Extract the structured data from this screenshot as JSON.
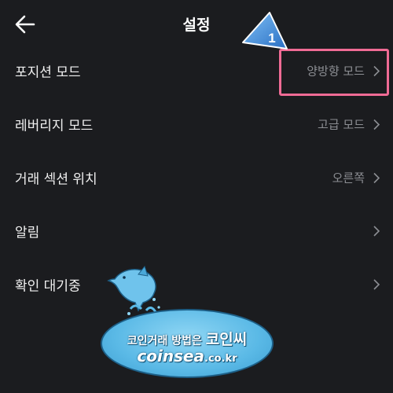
{
  "header": {
    "title": "설정",
    "back_icon": "arrow-left-icon"
  },
  "rows": [
    {
      "label": "포지션 모드",
      "value": "양방향 모드"
    },
    {
      "label": "레버리지 모드",
      "value": "고급 모드"
    },
    {
      "label": "거래 섹션 위치",
      "value": "오른쪽"
    },
    {
      "label": "알림",
      "value": ""
    },
    {
      "label": "확인 대기중",
      "value": ""
    }
  ],
  "annotation": {
    "step_number": "1",
    "color": "#f06b95",
    "pointer_color": "#3f8bd9"
  },
  "watermark": {
    "line1_prefix": "코인거래 방법은 ",
    "line1_brand": "코인씨",
    "domain_main": "coinsea",
    "domain_suffix": ".co.kr"
  },
  "colors": {
    "background": "#1b1c1f",
    "label_text": "#f0f0f0",
    "value_text": "#8c8e93",
    "chevron": "#8c8e93"
  }
}
